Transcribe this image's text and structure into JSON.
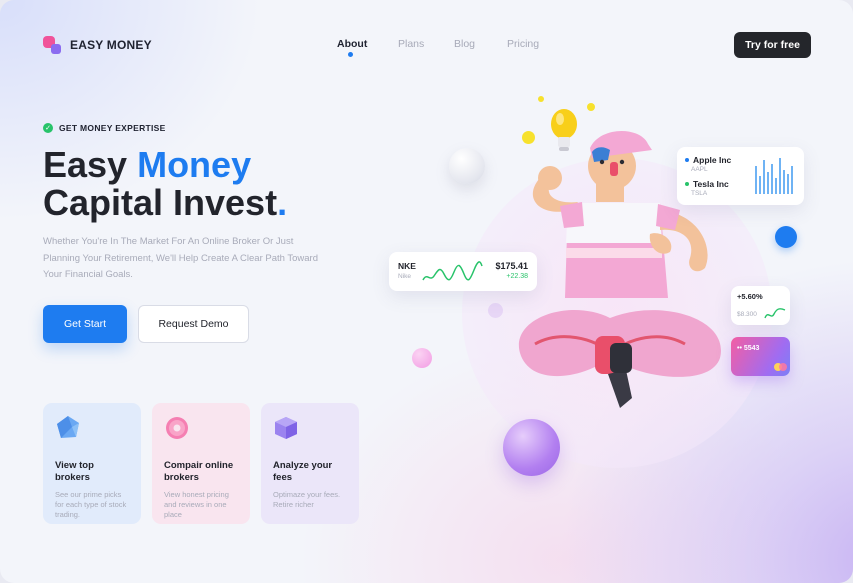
{
  "header": {
    "brand": "EASY MONEY",
    "nav": [
      {
        "label": "About",
        "active": true
      },
      {
        "label": "Plans",
        "active": false
      },
      {
        "label": "Blog",
        "active": false
      },
      {
        "label": "Pricing",
        "active": false
      }
    ],
    "cta": "Try for free"
  },
  "hero": {
    "kicker": "GET MONEY EXPERTISE",
    "title_line1_a": "Easy ",
    "title_line1_b": "Money",
    "title_line2": "Capital Invest",
    "title_dot": ".",
    "subtitle": "Whether You're In The Market For An Online Broker Or Just Planning Your Retirement, We'll Help Create A Clear Path Toward Your Financial Goals.",
    "primary_button": "Get Start",
    "secondary_button": "Request Demo"
  },
  "features": [
    {
      "title": "View top brokers",
      "desc": "See our prime picks for each type of stock trading.",
      "icon": "gem-icon"
    },
    {
      "title": "Compair online brokers",
      "desc": "View honest pricing and reviews in one place",
      "icon": "donut-icon"
    },
    {
      "title": "Analyze your fees",
      "desc": "Optimaze your fees. Retire richer",
      "icon": "cube-icon"
    }
  ],
  "widgets": {
    "nke": {
      "symbol": "NKE",
      "name": "Nike",
      "price": "$175.41",
      "change": "+22.38"
    },
    "stocks": [
      {
        "name": "Apple Inc",
        "ticker": "AAPL"
      },
      {
        "name": "Tesla Inc",
        "ticker": "TSLA"
      }
    ],
    "percent": {
      "change": "+5.60%",
      "value": "$8.300"
    },
    "card": {
      "number": "•• 5543"
    }
  },
  "colors": {
    "accent": "#1e7cf0",
    "dark": "#24262b",
    "positive": "#28c36a",
    "pink": "#f0539a",
    "purple": "#8b6cf0"
  }
}
